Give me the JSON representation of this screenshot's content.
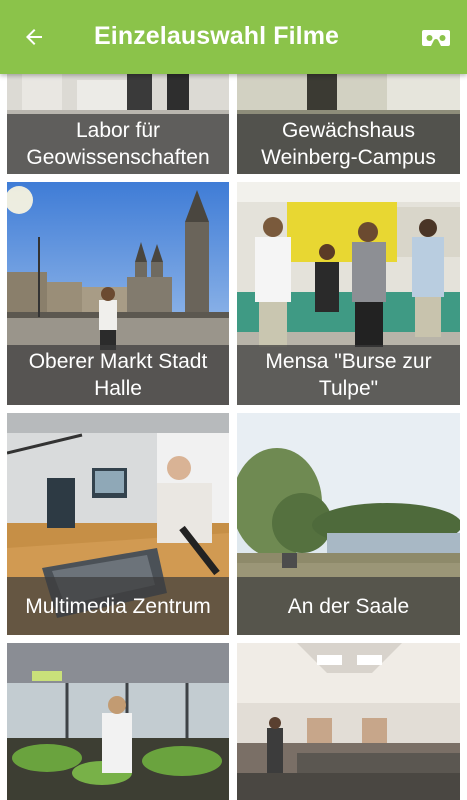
{
  "app_bar": {
    "title": "Einzelauswahl Filme",
    "back_icon": "arrow-back-icon",
    "vr_icon": "vr-headset-icon",
    "color": "#8bc34a"
  },
  "films": [
    {
      "title": "Labor für\nGeowissenschaften"
    },
    {
      "title": "Gewächshaus\nWeinberg-Campus"
    },
    {
      "title": "Oberer Markt Stadt\nHalle"
    },
    {
      "title": "Mensa \"Burse zur\nTulpe\""
    },
    {
      "title": "Multimedia Zentrum"
    },
    {
      "title": "An der Saale"
    },
    {
      "title": ""
    },
    {
      "title": ""
    }
  ]
}
